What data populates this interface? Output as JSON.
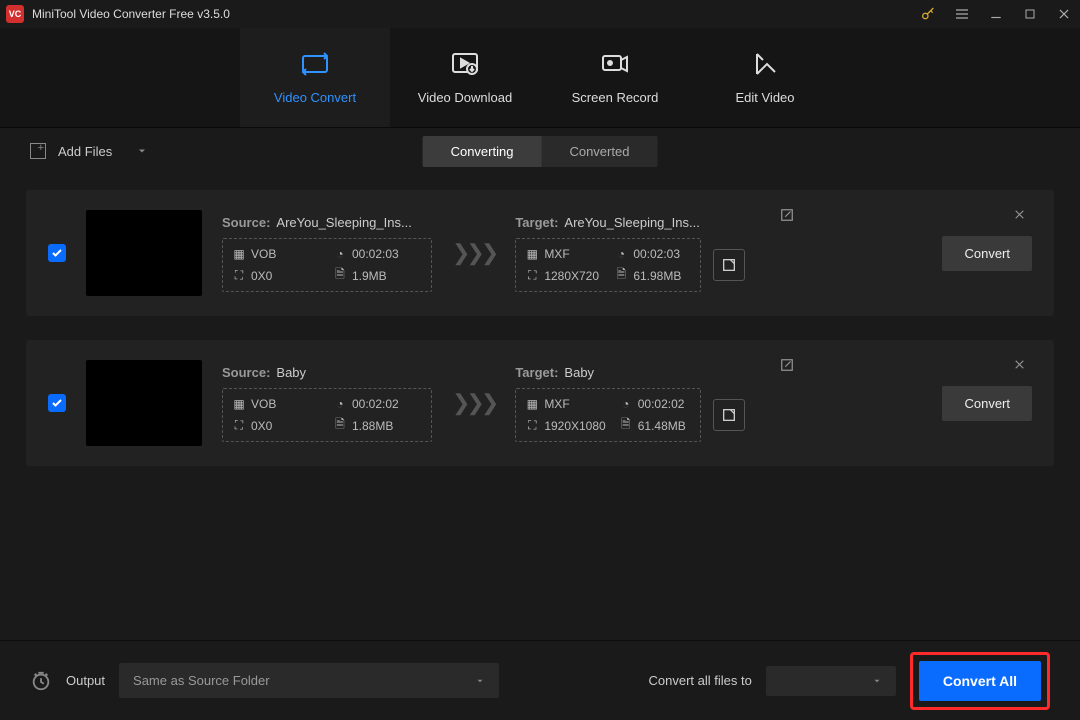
{
  "app": {
    "title": "MiniTool Video Converter Free v3.5.0"
  },
  "tabs": {
    "convert": "Video Convert",
    "download": "Video Download",
    "record": "Screen Record",
    "edit": "Edit Video"
  },
  "toolbar": {
    "add_files": "Add Files",
    "seg_converting": "Converting",
    "seg_converted": "Converted"
  },
  "labels": {
    "source": "Source:",
    "target": "Target:",
    "convert": "Convert"
  },
  "items": [
    {
      "source_name": "AreYou_Sleeping_Ins...",
      "source_format": "VOB",
      "source_duration": "00:02:03",
      "source_res": "0X0",
      "source_size": "1.9MB",
      "target_name": "AreYou_Sleeping_Ins...",
      "target_format": "MXF",
      "target_duration": "00:02:03",
      "target_res": "1280X720",
      "target_size": "61.98MB"
    },
    {
      "source_name": "Baby",
      "source_format": "VOB",
      "source_duration": "00:02:02",
      "source_res": "0X0",
      "source_size": "1.88MB",
      "target_name": "Baby",
      "target_format": "MXF",
      "target_duration": "00:02:02",
      "target_res": "1920X1080",
      "target_size": "61.48MB"
    }
  ],
  "footer": {
    "output_label": "Output",
    "output_value": "Same as Source Folder",
    "convert_all_label": "Convert all files to",
    "convert_all_value": "",
    "convert_all_btn": "Convert All"
  }
}
